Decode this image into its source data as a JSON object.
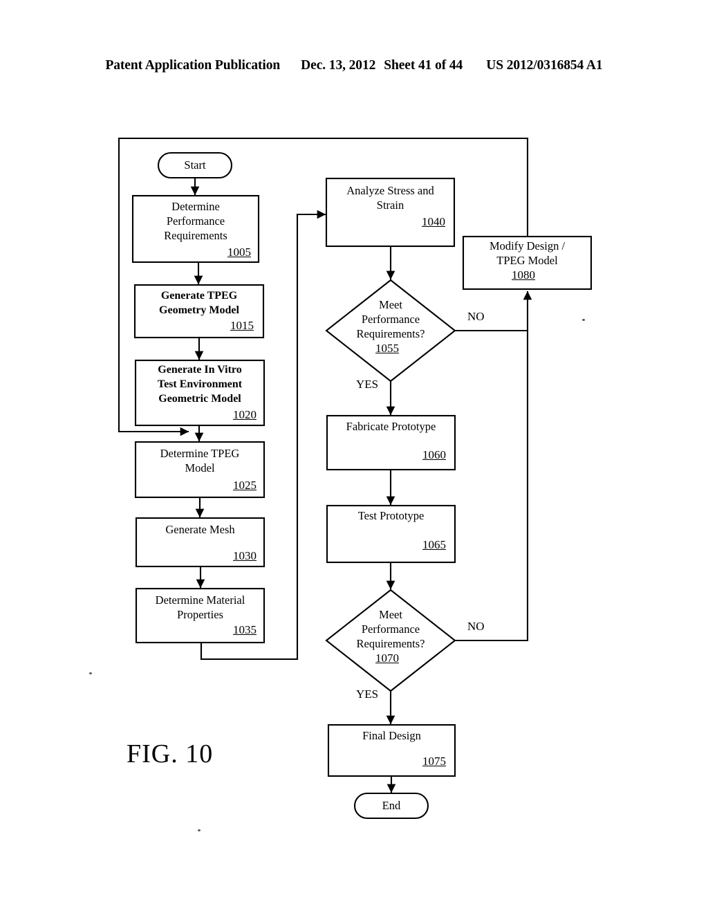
{
  "header": {
    "publication": "Patent Application Publication",
    "date": "Dec. 13, 2012",
    "sheet": "Sheet 41 of 44",
    "doc_number": "US 2012/0316854 A1"
  },
  "figure": {
    "caption": "FIG. 10",
    "terminators": {
      "start": "Start",
      "end": "End"
    },
    "edge_labels": {
      "no_1": "NO",
      "yes_1": "YES",
      "no_2": "NO",
      "yes_2": "YES"
    },
    "nodes": [
      {
        "id": "start",
        "shape": "terminator",
        "label": "Start"
      },
      {
        "id": "n1005",
        "shape": "process",
        "label": "Determine\nPerformance\nRequirements",
        "line1": "Determine",
        "line2": "Performance",
        "line3": "Requirements",
        "ref": "1005"
      },
      {
        "id": "n1015",
        "shape": "process",
        "label": "Generate TPEG\nGeometry Model",
        "line1": "Generate TPEG",
        "line2": "Geometry Model",
        "ref": "1015"
      },
      {
        "id": "n1020",
        "shape": "process",
        "label": "Generate In Vitro\nTest Environment\nGeometric Model",
        "line1": "Generate In Vitro",
        "line2": "Test Environment",
        "line3": "Geometric Model",
        "ref": "1020"
      },
      {
        "id": "n1025",
        "shape": "process",
        "label": "Determine TPEG\nModel",
        "line1": "Determine TPEG",
        "line2": "Model",
        "ref": "1025"
      },
      {
        "id": "n1030",
        "shape": "process",
        "label": "Generate Mesh",
        "line1": "Generate Mesh",
        "ref": "1030"
      },
      {
        "id": "n1035",
        "shape": "process",
        "label": "Determine Material\nProperties",
        "line1": "Determine Material",
        "line2": "Properties",
        "ref": "1035"
      },
      {
        "id": "n1040",
        "shape": "process",
        "label": "Analyze Stress  and\nStrain",
        "line1": "Analyze Stress  and",
        "line2": "Strain",
        "ref": "1040"
      },
      {
        "id": "n1055",
        "shape": "decision",
        "label": "Meet\nPerformance\nRequirements?",
        "line1": "Meet",
        "line2": "Performance",
        "line3": "Requirements?",
        "ref": "1055"
      },
      {
        "id": "n1060",
        "shape": "process",
        "label": "Fabricate Prototype",
        "line1": "Fabricate Prototype",
        "ref": "1060"
      },
      {
        "id": "n1065",
        "shape": "process",
        "label": "Test Prototype",
        "line1": "Test Prototype",
        "ref": "1065"
      },
      {
        "id": "n1070",
        "shape": "decision",
        "label": "Meet\nPerformance\nRequirements?",
        "line1": "Meet",
        "line2": "Performance",
        "line3": "Requirements?",
        "ref": "1070"
      },
      {
        "id": "n1075",
        "shape": "process",
        "label": "Final Design",
        "line1": "Final Design",
        "ref": "1075"
      },
      {
        "id": "n1080",
        "shape": "process",
        "label": "Modify Design /\nTPEG Model",
        "line1": "Modify Design /",
        "line2": "TPEG Model",
        "ref": "1080"
      },
      {
        "id": "end",
        "shape": "terminator",
        "label": "End"
      }
    ]
  },
  "colors": {
    "ink": "#000000",
    "paper": "#ffffff"
  }
}
